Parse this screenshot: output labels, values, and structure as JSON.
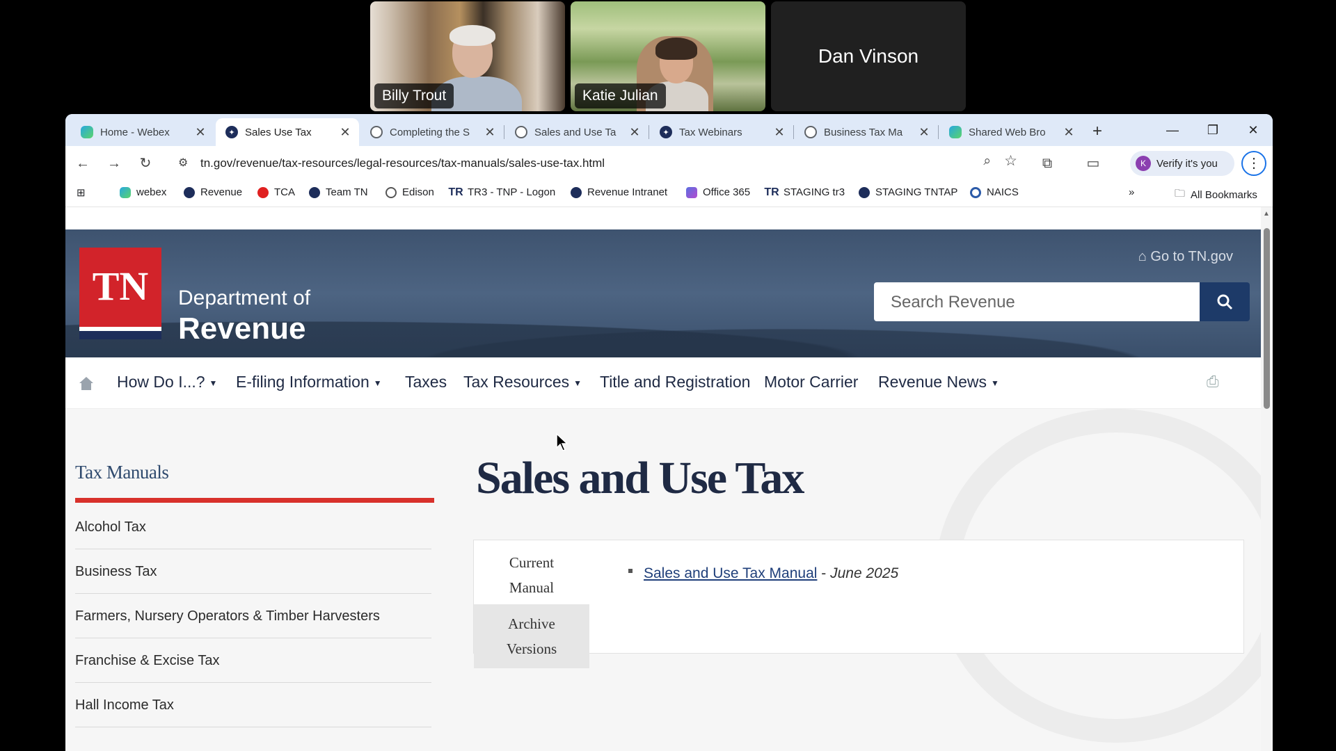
{
  "participants": [
    {
      "name": "Billy Trout"
    },
    {
      "name": "Katie Julian"
    },
    {
      "name": "Dan Vinson"
    }
  ],
  "browser": {
    "tabs": [
      {
        "title": "Home - Webex",
        "favicon": "webex-icon",
        "active": false
      },
      {
        "title": "Sales Use Tax",
        "favicon": "tn-icon",
        "active": true
      },
      {
        "title": "Completing the S",
        "favicon": "globe-icon",
        "active": false
      },
      {
        "title": "Sales and Use Ta",
        "favicon": "globe-icon",
        "active": false
      },
      {
        "title": "Tax Webinars",
        "favicon": "tn-icon",
        "active": false
      },
      {
        "title": "Business Tax Ma",
        "favicon": "globe-icon",
        "active": false
      },
      {
        "title": "Shared Web Bro",
        "favicon": "webex-icon",
        "active": false
      }
    ],
    "url": "tn.gov/revenue/tax-resources/legal-resources/tax-manuals/sales-use-tax.html",
    "verify_label": "Verify it's you",
    "profile_initial": "K",
    "bookmarks": [
      {
        "label": "webex",
        "icon": "webex-icon"
      },
      {
        "label": "Revenue",
        "icon": "tn-icon"
      },
      {
        "label": "TCA",
        "icon": "red-dot-icon"
      },
      {
        "label": "Team TN",
        "icon": "tn-icon"
      },
      {
        "label": "Edison",
        "icon": "globe-icon"
      },
      {
        "label": "TR3 - TNP - Logon",
        "icon": "tr-icon"
      },
      {
        "label": "Revenue Intranet",
        "icon": "tn-icon"
      },
      {
        "label": "Office 365",
        "icon": "office-icon"
      },
      {
        "label": "STAGING tr3",
        "icon": "tr-icon"
      },
      {
        "label": "STAGING TNTAP",
        "icon": "tn-icon"
      },
      {
        "label": "NAICS",
        "icon": "naics-icon"
      }
    ],
    "all_bookmarks_label": "All Bookmarks"
  },
  "site": {
    "logo_text": "TN",
    "dept_line1": "Department of",
    "dept_line2": "Revenue",
    "go_tn": "Go to TN.gov",
    "search_placeholder": "Search Revenue",
    "nav": [
      {
        "label": "How Do I...?",
        "dropdown": true
      },
      {
        "label": "E-filing Information",
        "dropdown": true
      },
      {
        "label": "Taxes",
        "dropdown": false
      },
      {
        "label": "Tax Resources",
        "dropdown": true
      },
      {
        "label": "Title and Registration",
        "dropdown": false
      },
      {
        "label": "Motor Carrier",
        "dropdown": false
      },
      {
        "label": "Revenue News",
        "dropdown": true
      }
    ],
    "sidebar_title": "Tax Manuals",
    "sidebar_items": [
      "Alcohol Tax",
      "Business Tax",
      "Farmers, Nursery Operators & Timber Harvesters",
      "Franchise & Excise Tax",
      "Hall Income Tax"
    ],
    "page_title": "Sales and Use Tax",
    "tabs": {
      "current": "Current Manual",
      "archive": "Archive Versions"
    },
    "current_manual": {
      "link": "Sales and Use Tax Manual",
      "separator": " - ",
      "date": "June 2025"
    }
  },
  "colors": {
    "tn_red": "#d2232a",
    "tn_navy": "#1d2d5a",
    "hero_blue": "#4d6482"
  }
}
